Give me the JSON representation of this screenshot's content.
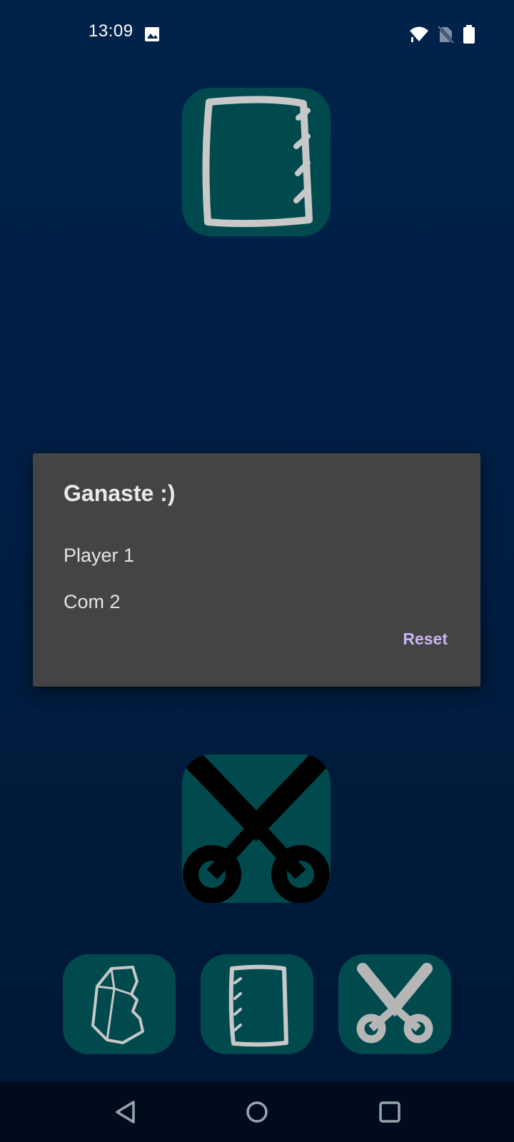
{
  "status_bar": {
    "time": "13:09",
    "icons": [
      "image-notification-icon",
      "wifi-icon",
      "no-sim-icon",
      "battery-icon"
    ]
  },
  "computer_choice": {
    "icon": "paper-icon",
    "label": ""
  },
  "player_choice": {
    "icon": "scissors-icon",
    "label": ""
  },
  "choices": [
    {
      "icon": "rock-icon"
    },
    {
      "icon": "paper-icon"
    },
    {
      "icon": "scissors-icon"
    }
  ],
  "dialog": {
    "title": "Ganaste :)",
    "player_score": "Player 1",
    "computer_score": "Com 2",
    "reset_label": "Reset"
  },
  "nav": {
    "icons": [
      "back-icon",
      "home-icon",
      "recents-icon"
    ]
  },
  "colors": {
    "tile": "#004a4e",
    "dialog_bg": "#444444",
    "accent": "#c9b5f5",
    "sketch": "#c8c8c8"
  }
}
